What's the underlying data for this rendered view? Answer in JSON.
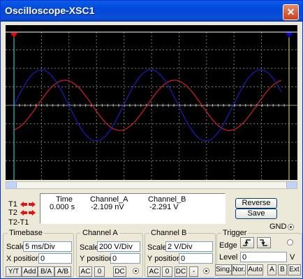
{
  "window": {
    "title": "Oscilloscope-XSC1",
    "close_glyph": "✕"
  },
  "screen": {
    "background": "#000000",
    "grid_color": "#7a7a7a",
    "trace_a_color": "#1a1ab0",
    "trace_b_color": "#c81e1e",
    "cursor1_color": "#ff0000",
    "cursor2_color": "#0000ff",
    "cursor1_line_color": "#2ef0f0",
    "cursor2_line_color": "#f0f000"
  },
  "readout": {
    "t1_label": "T1",
    "t2_label": "T2",
    "t21_label": "T2-T1",
    "headers": {
      "time": "Time",
      "channel_a": "Channel_A",
      "channel_b": "Channel_B"
    },
    "row_t1": {
      "time": "0.000 s",
      "channel_a": "-2.109 nV",
      "channel_b": "-2.291 V"
    }
  },
  "buttons": {
    "reverse": "Reverse",
    "save": "Save"
  },
  "gnd_label": "GND",
  "timebase": {
    "title": "Timebase",
    "scale_label": "Scale",
    "scale_value": "5 ms/Div",
    "xpos_label": "X position",
    "xpos_value": "0",
    "modes": [
      "Y/T",
      "Add",
      "B/A",
      "A/B"
    ]
  },
  "channel_a": {
    "title": "Channel A",
    "scale_label": "Scale",
    "scale_value": "200  V/Div",
    "ypos_label": "Y position",
    "ypos_value": "0",
    "coupling": [
      "AC",
      "0",
      "DC"
    ]
  },
  "channel_b": {
    "title": "Channel B",
    "scale_label": "Scale",
    "scale_value": "2  V/Div",
    "ypos_label": "Y position",
    "ypos_value": "0",
    "coupling": [
      "AC",
      "0",
      "DC",
      "-"
    ]
  },
  "trigger": {
    "title": "Trigger",
    "edge_label": "Edge",
    "level_label": "Level",
    "level_value": "0",
    "level_unit": "V",
    "modes": [
      "Sing.",
      "Nor.",
      "Auto"
    ],
    "sources": [
      "A",
      "B",
      "Ext"
    ]
  }
}
